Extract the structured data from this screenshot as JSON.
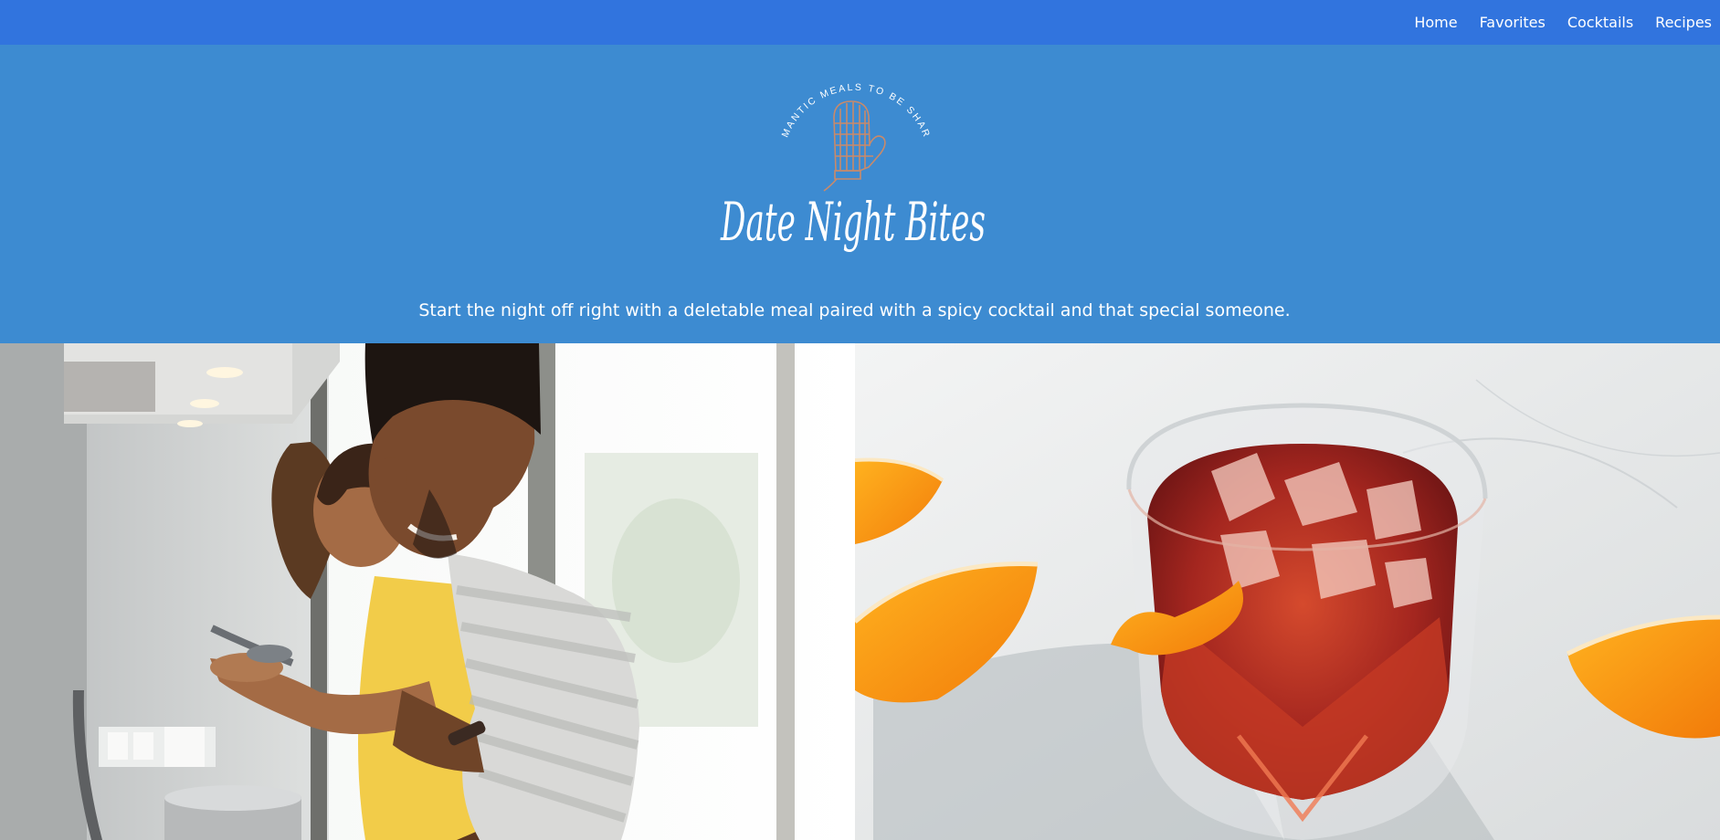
{
  "nav": {
    "links": [
      "Home",
      "Favorites",
      "Cocktails",
      "Recipes"
    ]
  },
  "brand": {
    "arc_text": "ROMANTIC MEALS TO BE SHARED",
    "name": "Date Night Bites"
  },
  "hero": {
    "tagline": "Start the night off right with a deletable meal paired with a spicy cocktail and that special someone."
  },
  "images": {
    "left_alt": "couple cooking together in a bright kitchen",
    "right_alt": "red cocktail over ice with orange slices"
  },
  "colors": {
    "nav_bg": "#3174de",
    "hero_bg": "#3d8bd1",
    "logo_accent": "#c98a6a"
  }
}
